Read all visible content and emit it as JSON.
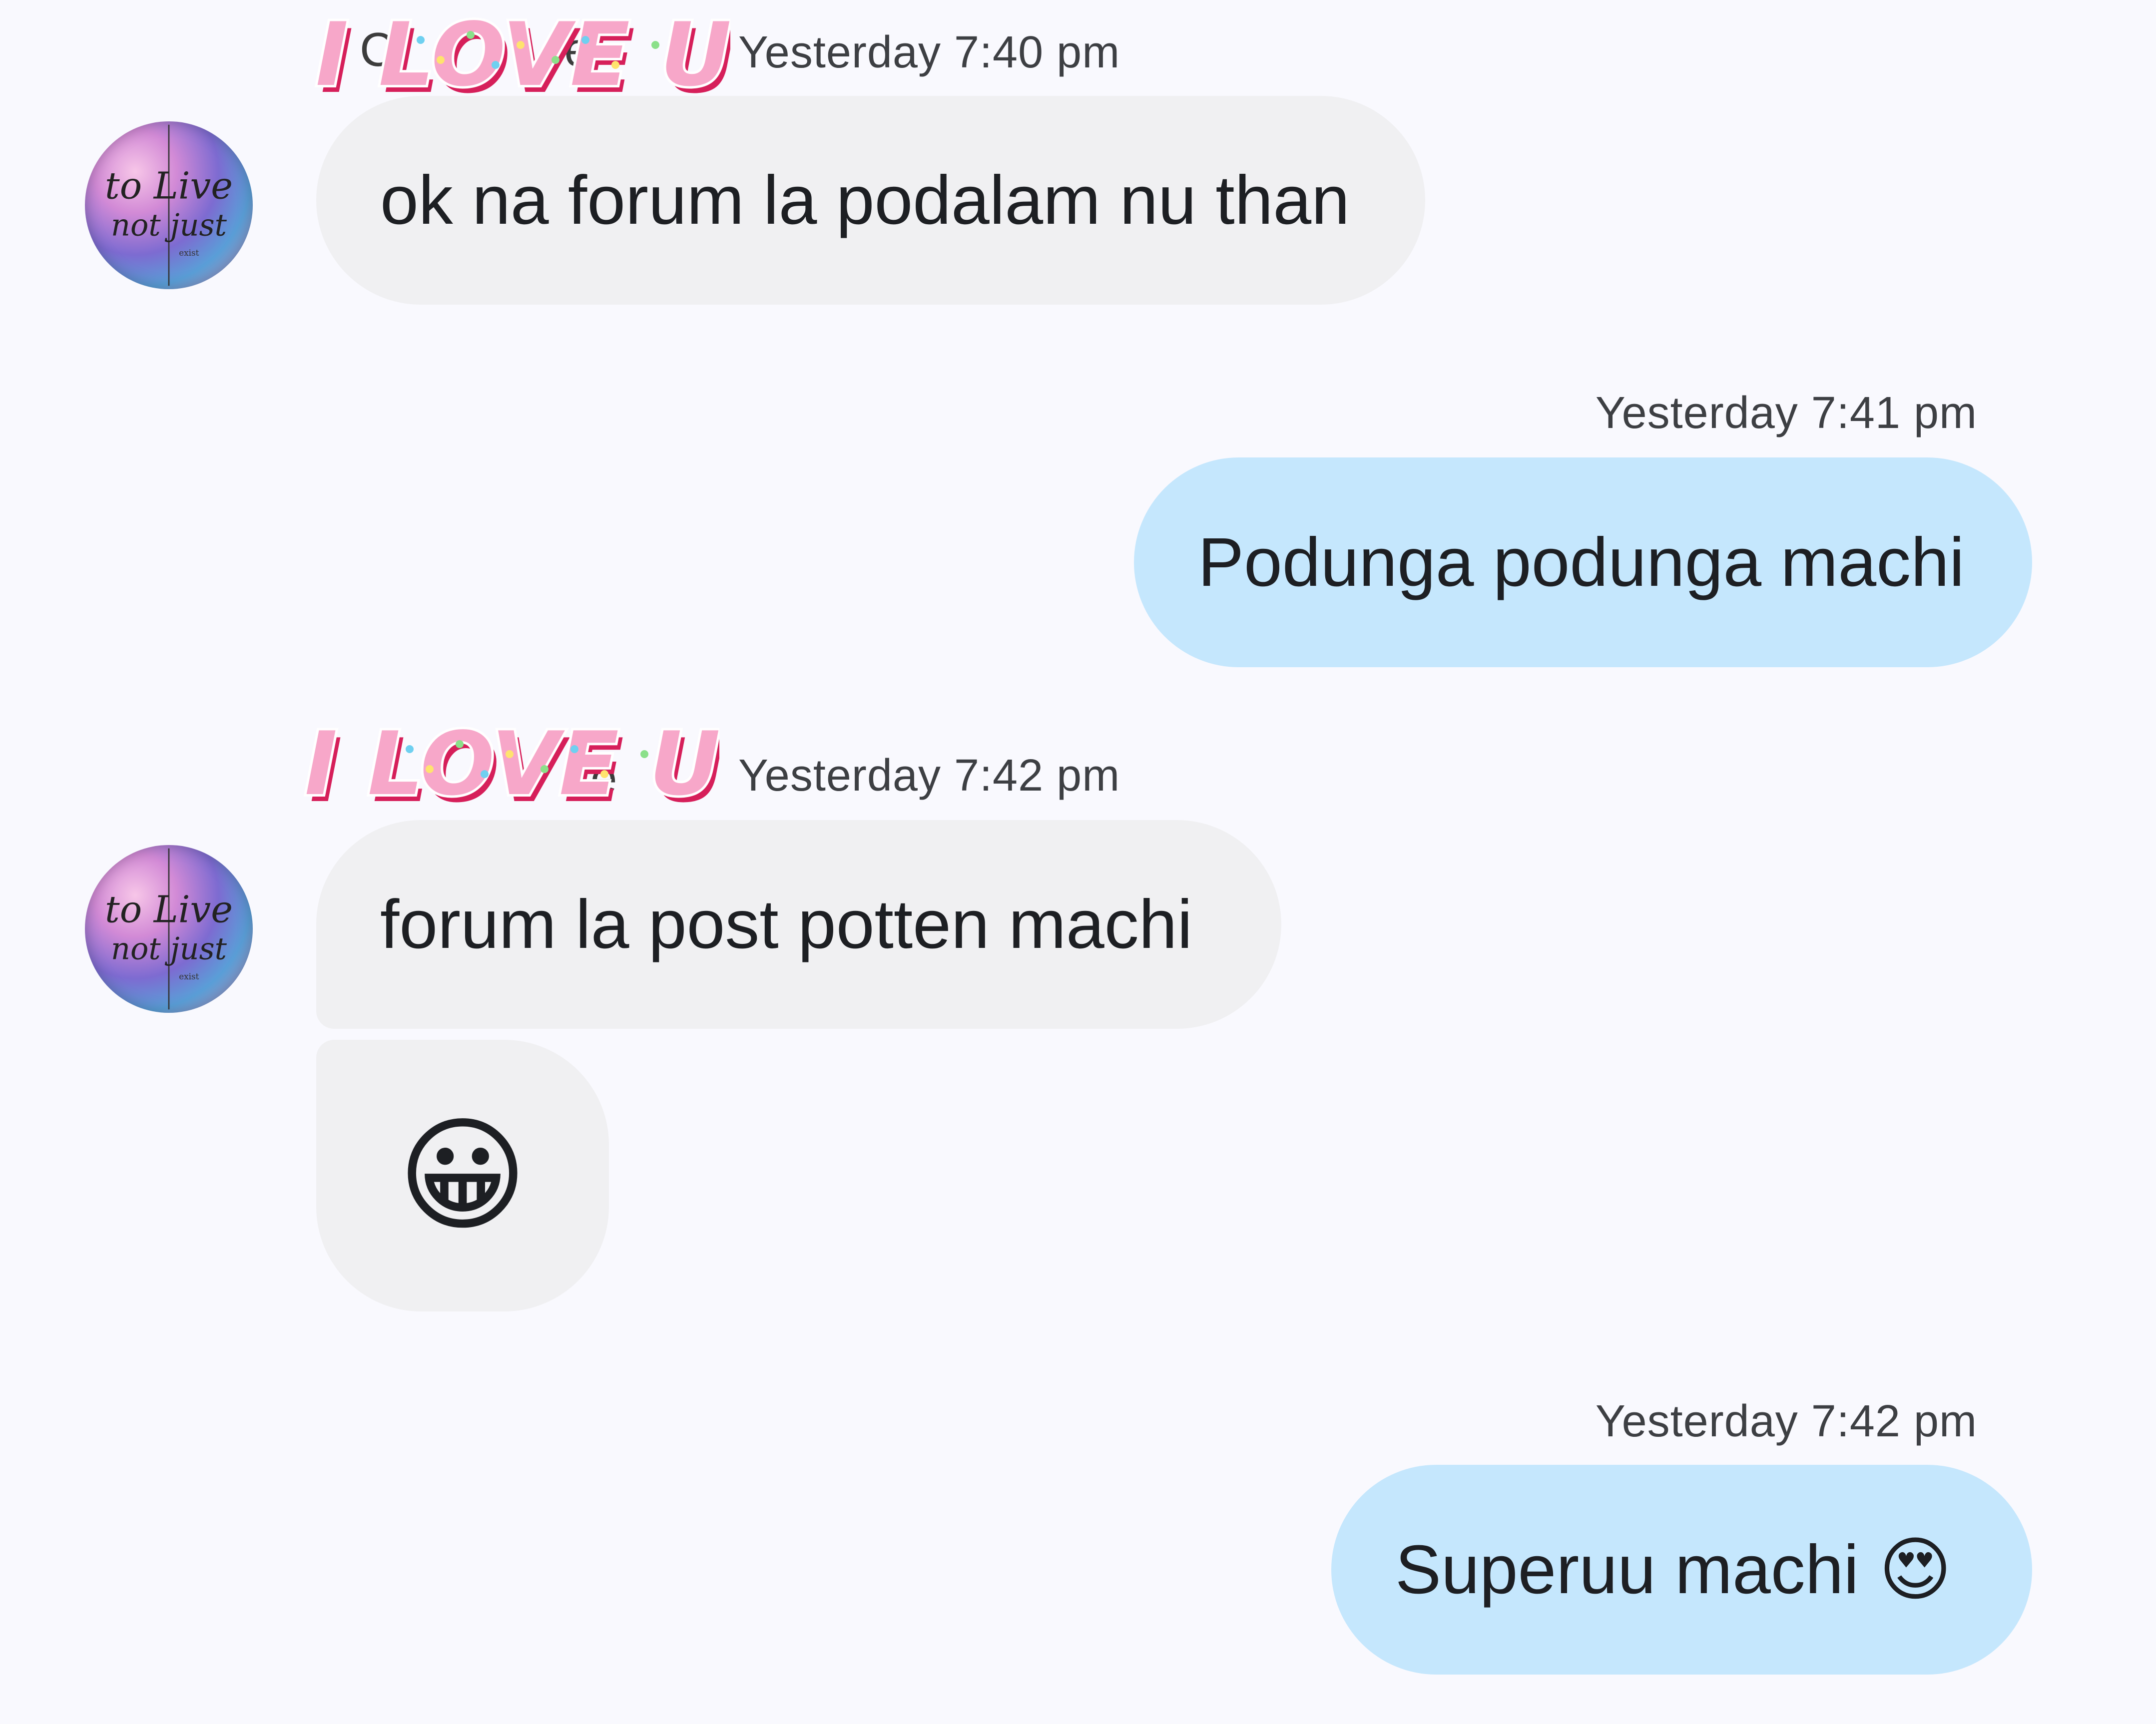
{
  "messages": [
    {
      "direction": "incoming",
      "sender": "C",
      "sender_tail": "e",
      "time": "Yesterday 7:40 pm",
      "text": "ok na forum la podalam nu than"
    },
    {
      "direction": "outgoing",
      "time": "Yesterday 7:41 pm",
      "text": "Podunga podunga machi"
    },
    {
      "direction": "incoming",
      "sender_tail": "re",
      "time": "Yesterday 7:42 pm",
      "text": "forum la post potten machi",
      "emoji": "😀"
    },
    {
      "direction": "outgoing",
      "time": "Yesterday 7:42 pm",
      "text": "Superuu machi",
      "emoji": "😍"
    }
  ],
  "sticker": {
    "text": "I LOVE U",
    "colors": {
      "fill": "#f7a7c9",
      "shadow": "#d61f5a",
      "outline": "#ffffff"
    }
  },
  "avatar": {
    "text_line1": "to Live",
    "text_line2": "not just",
    "small_word": "exist"
  },
  "colors": {
    "background": "#f9f9fe",
    "incoming_bubble": "#f0f0f2",
    "outgoing_bubble": "#c5e7fd",
    "text": "#1d1f23",
    "timestamp": "#3d3f43"
  }
}
